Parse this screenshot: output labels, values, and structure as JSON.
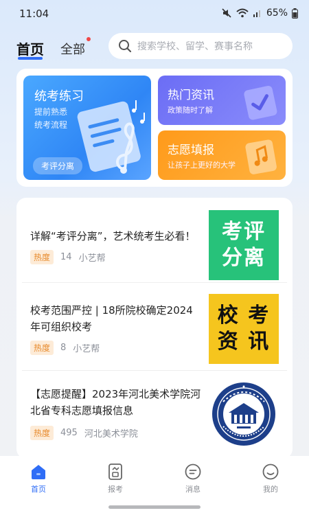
{
  "status_bar": {
    "time": "11:04",
    "battery": "65%",
    "icons": [
      "mute-icon",
      "wifi-icon",
      "signal-icon",
      "battery-icon"
    ]
  },
  "header": {
    "tabs": [
      {
        "label": "首页",
        "active": true
      },
      {
        "label": "全部",
        "active": false,
        "has_dot": true
      }
    ],
    "search": {
      "placeholder": "搜索学校、留学、赛事名称",
      "icon": "search-icon"
    }
  },
  "features": {
    "big": {
      "title": "统考练习",
      "sub1": "提前熟悉",
      "sub2": "统考流程",
      "button": "考评分离",
      "color": "#2f86f5"
    },
    "hot": {
      "title": "热门资讯",
      "sub": "政策随时了解",
      "color": "#6b6df5"
    },
    "volunteer": {
      "title": "志愿填报",
      "sub": "让孩子上更好的大学",
      "color": "#ff9a1a"
    }
  },
  "articles": [
    {
      "title": "详解“考评分离”，艺术统考生必看！",
      "badge": "热度",
      "heat": "14",
      "source": "小艺帮",
      "thumb_line1": "考评",
      "thumb_line2": "分离",
      "thumb_bg": "#27c27a",
      "thumb_fg": "#ffffff"
    },
    {
      "title": "校考范围严控 | 18所院校确定2024年可组织校考",
      "badge": "热度",
      "heat": "8",
      "source": "小艺帮",
      "thumb_line1": "校 考",
      "thumb_line2": "资 讯",
      "thumb_bg": "#f5c51e",
      "thumb_fg": "#111111"
    },
    {
      "title": "【志愿提醒】2023年河北美术学院河北省专科志愿填报信息",
      "badge": "热度",
      "heat": "495",
      "source": "河北美术学院",
      "thumb_type": "logo"
    }
  ],
  "bottom_nav": [
    {
      "label": "首页",
      "icon": "home-icon",
      "active": true
    },
    {
      "label": "报考",
      "icon": "apply-icon",
      "active": false
    },
    {
      "label": "消息",
      "icon": "message-icon",
      "active": false
    },
    {
      "label": "我的",
      "icon": "profile-icon",
      "active": false
    }
  ],
  "colors": {
    "accent": "#2f6df6",
    "heat_badge_bg": "#fdebd7",
    "heat_badge_fg": "#e78a2c",
    "new_dot": "#f04848"
  }
}
